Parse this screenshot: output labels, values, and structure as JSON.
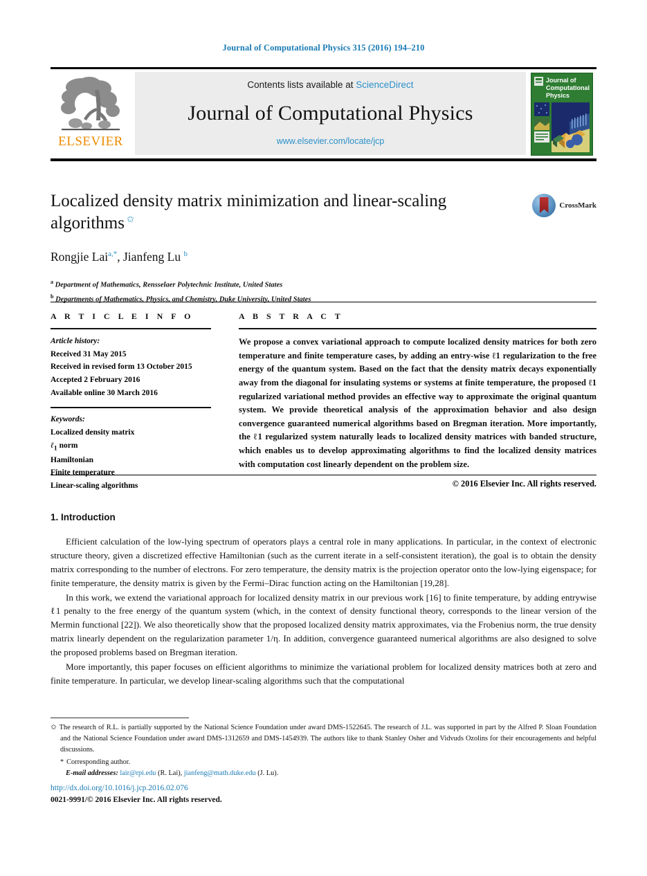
{
  "running_head": "Journal of Computational Physics 315 (2016) 194–210",
  "masthead": {
    "publisher_logo_text": "ELSEVIER",
    "contents_prefix": "Contents lists available at",
    "contents_link": "ScienceDirect",
    "journal_name": "Journal of Computational Physics",
    "journal_url": "www.elsevier.com/locate/jcp",
    "cover_title_line1": "Journal of",
    "cover_title_line2": "Computational",
    "cover_title_line3": "Physics"
  },
  "article": {
    "title": "Localized density matrix minimization and linear-scaling algorithms",
    "title_star": "✩",
    "crossmark_label": "CrossMark",
    "authors": "Rongjie Lai, Jianfeng Lu",
    "author_1_name": "Rongjie Lai",
    "author_1_sup": "a,*",
    "author_2_name": "Jianfeng Lu",
    "author_2_sup": "b",
    "affiliations": [
      {
        "marker": "a",
        "text": "Department of Mathematics, Rensselaer Polytechnic Institute, United States"
      },
      {
        "marker": "b",
        "text": "Departments of Mathematics, Physics, and Chemistry, Duke University, United States"
      }
    ]
  },
  "info": {
    "heading": "A R T I C L E   I N F O",
    "history_title": "Article history:",
    "history": [
      "Received 31 May 2015",
      "Received in revised form 13 October 2015",
      "Accepted 2 February 2016",
      "Available online 30 March 2016"
    ],
    "keywords_title": "Keywords:",
    "keywords": [
      "Localized density matrix",
      "ℓ1 norm",
      "Hamiltonian",
      "Finite temperature",
      "Linear-scaling algorithms"
    ],
    "keyword_l1_base": "ℓ",
    "keyword_l1_sub": "1",
    "keyword_l1_rest": " norm"
  },
  "abstract": {
    "heading": "A B S T R A C T",
    "text": "We propose a convex variational approach to compute localized density matrices for both zero temperature and finite temperature cases, by adding an entry-wise ℓ1 regularization to the free energy of the quantum system. Based on the fact that the density matrix decays exponentially away from the diagonal for insulating systems or systems at finite temperature, the proposed ℓ1 regularized variational method provides an effective way to approximate the original quantum system. We provide theoretical analysis of the approximation behavior and also design convergence guaranteed numerical algorithms based on Bregman iteration. More importantly, the ℓ1 regularized system naturally leads to localized density matrices with banded structure, which enables us to develop approximating algorithms to find the localized density matrices with computation cost linearly dependent on the problem size.",
    "copyright": "© 2016 Elsevier Inc. All rights reserved."
  },
  "body": {
    "section_number": "1.",
    "section_title": "Introduction",
    "section_heading": "1. Introduction",
    "paragraphs": [
      "Efficient calculation of the low-lying spectrum of operators plays a central role in many applications. In particular, in the context of electronic structure theory, given a discretized effective Hamiltonian (such as the current iterate in a self-consistent iteration), the goal is to obtain the density matrix corresponding to the number of electrons. For zero temperature, the density matrix is the projection operator onto the low-lying eigenspace; for finite temperature, the density matrix is given by the Fermi–Dirac function acting on the Hamiltonian [19,28].",
      "In this work, we extend the variational approach for localized density matrix in our previous work [16] to finite temperature, by adding entrywise ℓ1 penalty to the free energy of the quantum system (which, in the context of density functional theory, corresponds to the linear version of the Mermin functional [22]). We also theoretically show that the proposed localized density matrix approximates, via the Frobenius norm, the true density matrix linearly dependent on the regularization parameter 1/η. In addition, convergence guaranteed numerical algorithms are also designed to solve the proposed problems based on Bregman iteration.",
      "More importantly, this paper focuses on efficient algorithms to minimize the variational problem for localized density matrices both at zero and finite temperature. In particular, we develop linear-scaling algorithms such that the computational"
    ],
    "refs": [
      "[19,28]",
      "[16]",
      "[22]"
    ]
  },
  "footnotes": {
    "star_marker": "✩",
    "funding": "The research of R.L. is partially supported by the National Science Foundation under award DMS-1522645. The research of J.L. was supported in part by the Alfred P. Sloan Foundation and the National Science Foundation under award DMS-1312659 and DMS-1454939. The authors like to thank Stanley Osher and Vidvuds Ozolins for their encouragements and helpful discussions.",
    "corresponding_marker": "*",
    "corresponding": "Corresponding author.",
    "email_label": "E-mail addresses:",
    "email_1": "lair@rpi.edu",
    "email_1_owner": "(R. Lai),",
    "email_2": "jianfeng@math.duke.edu",
    "email_2_owner": "(J. Lu)."
  },
  "footer": {
    "doi": "http://dx.doi.org/10.1016/j.jcp.2016.02.076",
    "issn_line": "0021-9991/© 2016 Elsevier Inc. All rights reserved."
  },
  "colors": {
    "link_blue": "#1a7bb5",
    "accent_blue": "#2b90c8",
    "elsevier_orange": "#ed8b00",
    "cover_green": "#2e7d32"
  }
}
